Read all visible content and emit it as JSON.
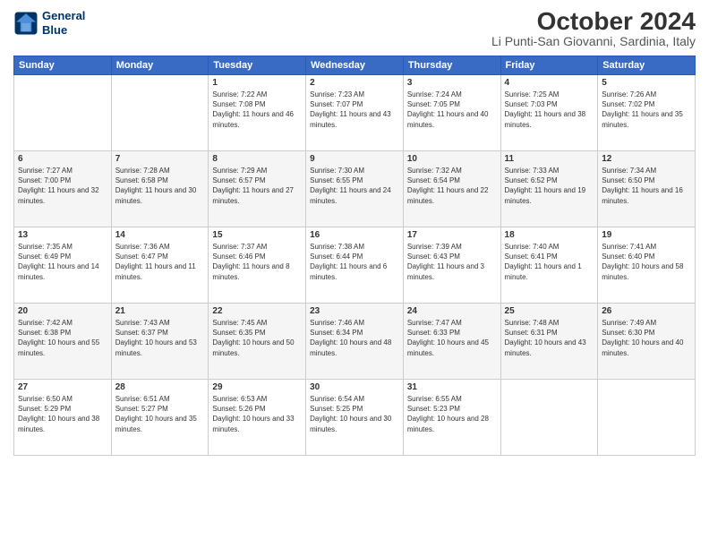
{
  "header": {
    "logo_line1": "General",
    "logo_line2": "Blue",
    "month": "October 2024",
    "location": "Li Punti-San Giovanni, Sardinia, Italy"
  },
  "weekdays": [
    "Sunday",
    "Monday",
    "Tuesday",
    "Wednesday",
    "Thursday",
    "Friday",
    "Saturday"
  ],
  "weeks": [
    [
      {
        "day": "",
        "sunrise": "",
        "sunset": "",
        "daylight": ""
      },
      {
        "day": "",
        "sunrise": "",
        "sunset": "",
        "daylight": ""
      },
      {
        "day": "1",
        "sunrise": "Sunrise: 7:22 AM",
        "sunset": "Sunset: 7:08 PM",
        "daylight": "Daylight: 11 hours and 46 minutes."
      },
      {
        "day": "2",
        "sunrise": "Sunrise: 7:23 AM",
        "sunset": "Sunset: 7:07 PM",
        "daylight": "Daylight: 11 hours and 43 minutes."
      },
      {
        "day": "3",
        "sunrise": "Sunrise: 7:24 AM",
        "sunset": "Sunset: 7:05 PM",
        "daylight": "Daylight: 11 hours and 40 minutes."
      },
      {
        "day": "4",
        "sunrise": "Sunrise: 7:25 AM",
        "sunset": "Sunset: 7:03 PM",
        "daylight": "Daylight: 11 hours and 38 minutes."
      },
      {
        "day": "5",
        "sunrise": "Sunrise: 7:26 AM",
        "sunset": "Sunset: 7:02 PM",
        "daylight": "Daylight: 11 hours and 35 minutes."
      }
    ],
    [
      {
        "day": "6",
        "sunrise": "Sunrise: 7:27 AM",
        "sunset": "Sunset: 7:00 PM",
        "daylight": "Daylight: 11 hours and 32 minutes."
      },
      {
        "day": "7",
        "sunrise": "Sunrise: 7:28 AM",
        "sunset": "Sunset: 6:58 PM",
        "daylight": "Daylight: 11 hours and 30 minutes."
      },
      {
        "day": "8",
        "sunrise": "Sunrise: 7:29 AM",
        "sunset": "Sunset: 6:57 PM",
        "daylight": "Daylight: 11 hours and 27 minutes."
      },
      {
        "day": "9",
        "sunrise": "Sunrise: 7:30 AM",
        "sunset": "Sunset: 6:55 PM",
        "daylight": "Daylight: 11 hours and 24 minutes."
      },
      {
        "day": "10",
        "sunrise": "Sunrise: 7:32 AM",
        "sunset": "Sunset: 6:54 PM",
        "daylight": "Daylight: 11 hours and 22 minutes."
      },
      {
        "day": "11",
        "sunrise": "Sunrise: 7:33 AM",
        "sunset": "Sunset: 6:52 PM",
        "daylight": "Daylight: 11 hours and 19 minutes."
      },
      {
        "day": "12",
        "sunrise": "Sunrise: 7:34 AM",
        "sunset": "Sunset: 6:50 PM",
        "daylight": "Daylight: 11 hours and 16 minutes."
      }
    ],
    [
      {
        "day": "13",
        "sunrise": "Sunrise: 7:35 AM",
        "sunset": "Sunset: 6:49 PM",
        "daylight": "Daylight: 11 hours and 14 minutes."
      },
      {
        "day": "14",
        "sunrise": "Sunrise: 7:36 AM",
        "sunset": "Sunset: 6:47 PM",
        "daylight": "Daylight: 11 hours and 11 minutes."
      },
      {
        "day": "15",
        "sunrise": "Sunrise: 7:37 AM",
        "sunset": "Sunset: 6:46 PM",
        "daylight": "Daylight: 11 hours and 8 minutes."
      },
      {
        "day": "16",
        "sunrise": "Sunrise: 7:38 AM",
        "sunset": "Sunset: 6:44 PM",
        "daylight": "Daylight: 11 hours and 6 minutes."
      },
      {
        "day": "17",
        "sunrise": "Sunrise: 7:39 AM",
        "sunset": "Sunset: 6:43 PM",
        "daylight": "Daylight: 11 hours and 3 minutes."
      },
      {
        "day": "18",
        "sunrise": "Sunrise: 7:40 AM",
        "sunset": "Sunset: 6:41 PM",
        "daylight": "Daylight: 11 hours and 1 minute."
      },
      {
        "day": "19",
        "sunrise": "Sunrise: 7:41 AM",
        "sunset": "Sunset: 6:40 PM",
        "daylight": "Daylight: 10 hours and 58 minutes."
      }
    ],
    [
      {
        "day": "20",
        "sunrise": "Sunrise: 7:42 AM",
        "sunset": "Sunset: 6:38 PM",
        "daylight": "Daylight: 10 hours and 55 minutes."
      },
      {
        "day": "21",
        "sunrise": "Sunrise: 7:43 AM",
        "sunset": "Sunset: 6:37 PM",
        "daylight": "Daylight: 10 hours and 53 minutes."
      },
      {
        "day": "22",
        "sunrise": "Sunrise: 7:45 AM",
        "sunset": "Sunset: 6:35 PM",
        "daylight": "Daylight: 10 hours and 50 minutes."
      },
      {
        "day": "23",
        "sunrise": "Sunrise: 7:46 AM",
        "sunset": "Sunset: 6:34 PM",
        "daylight": "Daylight: 10 hours and 48 minutes."
      },
      {
        "day": "24",
        "sunrise": "Sunrise: 7:47 AM",
        "sunset": "Sunset: 6:33 PM",
        "daylight": "Daylight: 10 hours and 45 minutes."
      },
      {
        "day": "25",
        "sunrise": "Sunrise: 7:48 AM",
        "sunset": "Sunset: 6:31 PM",
        "daylight": "Daylight: 10 hours and 43 minutes."
      },
      {
        "day": "26",
        "sunrise": "Sunrise: 7:49 AM",
        "sunset": "Sunset: 6:30 PM",
        "daylight": "Daylight: 10 hours and 40 minutes."
      }
    ],
    [
      {
        "day": "27",
        "sunrise": "Sunrise: 6:50 AM",
        "sunset": "Sunset: 5:29 PM",
        "daylight": "Daylight: 10 hours and 38 minutes."
      },
      {
        "day": "28",
        "sunrise": "Sunrise: 6:51 AM",
        "sunset": "Sunset: 5:27 PM",
        "daylight": "Daylight: 10 hours and 35 minutes."
      },
      {
        "day": "29",
        "sunrise": "Sunrise: 6:53 AM",
        "sunset": "Sunset: 5:26 PM",
        "daylight": "Daylight: 10 hours and 33 minutes."
      },
      {
        "day": "30",
        "sunrise": "Sunrise: 6:54 AM",
        "sunset": "Sunset: 5:25 PM",
        "daylight": "Daylight: 10 hours and 30 minutes."
      },
      {
        "day": "31",
        "sunrise": "Sunrise: 6:55 AM",
        "sunset": "Sunset: 5:23 PM",
        "daylight": "Daylight: 10 hours and 28 minutes."
      },
      {
        "day": "",
        "sunrise": "",
        "sunset": "",
        "daylight": ""
      },
      {
        "day": "",
        "sunrise": "",
        "sunset": "",
        "daylight": ""
      }
    ]
  ]
}
